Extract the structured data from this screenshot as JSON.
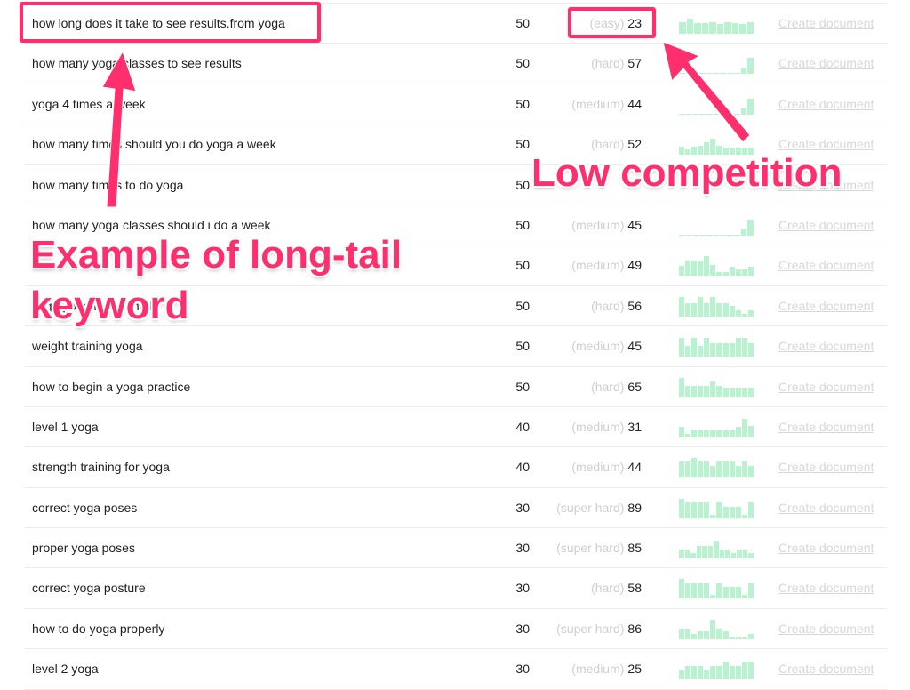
{
  "rows": [
    {
      "keyword": "how long does it take to see results.from yoga",
      "volume": "50",
      "difficulty_label": "(easy)",
      "difficulty": "23",
      "trend": [
        0.6,
        0.75,
        0.55,
        0.55,
        0.6,
        0.5,
        0.6,
        0.55,
        0.5,
        0.6
      ],
      "action": "Create document"
    },
    {
      "keyword": "how many yoga classes to see results",
      "volume": "50",
      "difficulty_label": "(hard)",
      "difficulty": "57",
      "trend": [
        0.02,
        0.02,
        0.02,
        0.02,
        0.02,
        0.02,
        0.02,
        0.02,
        0.02,
        0.3,
        0.8
      ],
      "action": "Create document"
    },
    {
      "keyword": "yoga 4 times a week",
      "volume": "50",
      "difficulty_label": "(medium)",
      "difficulty": "44",
      "trend": [
        0.02,
        0.02,
        0.02,
        0.02,
        0.02,
        0.02,
        0.02,
        0.02,
        0.02,
        0.3,
        0.8
      ],
      "action": "Create document"
    },
    {
      "keyword": "how many times should you do yoga a week",
      "volume": "50",
      "difficulty_label": "(hard)",
      "difficulty": "52",
      "trend": [
        0.4,
        0.25,
        0.4,
        0.45,
        0.65,
        0.8,
        0.45,
        0.35,
        0.3,
        0.35,
        0.35,
        0.35
      ],
      "action": "Create document"
    },
    {
      "keyword": "how many times to do yoga",
      "volume": "50",
      "difficulty_label": "",
      "difficulty": "",
      "trend": [],
      "action": "Create document"
    },
    {
      "keyword": "how many yoga classes should i do a week",
      "volume": "50",
      "difficulty_label": "(medium)",
      "difficulty": "45",
      "trend": [
        0.02,
        0.02,
        0.02,
        0.02,
        0.02,
        0.02,
        0.02,
        0.02,
        0.02,
        0.3,
        0.8
      ],
      "action": "Create document"
    },
    {
      "keyword": "",
      "volume": "50",
      "difficulty_label": "(medium)",
      "difficulty": "49",
      "trend": [
        0.5,
        0.75,
        0.75,
        0.75,
        1.0,
        0.55,
        0.2,
        0.2,
        0.45,
        0.3,
        0.3,
        0.45
      ],
      "action": "Create document"
    },
    {
      "keyword": "yoga good for strength",
      "volume": "50",
      "difficulty_label": "(hard)",
      "difficulty": "56",
      "trend": [
        1.0,
        0.7,
        0.7,
        1.0,
        0.7,
        1.0,
        0.7,
        0.7,
        0.55,
        0.3,
        0.15,
        0.3
      ],
      "action": "Create document"
    },
    {
      "keyword": "weight training yoga",
      "volume": "50",
      "difficulty_label": "(medium)",
      "difficulty": "45",
      "trend": [
        0.95,
        0.55,
        0.95,
        0.55,
        0.95,
        0.7,
        0.7,
        0.7,
        0.7,
        0.95,
        0.95,
        0.7
      ],
      "action": "Create document"
    },
    {
      "keyword": "how to begin a yoga practice",
      "volume": "50",
      "difficulty_label": "(hard)",
      "difficulty": "65",
      "trend": [
        1.0,
        0.6,
        0.6,
        0.6,
        0.6,
        0.8,
        0.6,
        0.5,
        0.5,
        0.5,
        0.5,
        0.5
      ],
      "action": "Create document"
    },
    {
      "keyword": "level 1 yoga",
      "volume": "40",
      "difficulty_label": "(medium)",
      "difficulty": "31",
      "trend": [
        0.55,
        0.2,
        0.35,
        0.35,
        0.35,
        0.35,
        0.35,
        0.35,
        0.35,
        0.55,
        0.95,
        0.6
      ],
      "action": "Create document"
    },
    {
      "keyword": "strength training for yoga",
      "volume": "40",
      "difficulty_label": "(medium)",
      "difficulty": "44",
      "trend": [
        0.8,
        0.8,
        1.0,
        0.8,
        0.8,
        0.6,
        0.8,
        0.8,
        0.8,
        0.6,
        0.8,
        0.6
      ],
      "action": "Create document"
    },
    {
      "keyword": "correct yoga poses",
      "volume": "30",
      "difficulty_label": "(super hard)",
      "difficulty": "89",
      "trend": [
        1.0,
        0.8,
        0.8,
        0.8,
        0.8,
        0.2,
        0.8,
        0.6,
        0.6,
        0.6,
        0.2,
        0.8
      ],
      "action": "Create document"
    },
    {
      "keyword": "proper yoga poses",
      "volume": "30",
      "difficulty_label": "(super hard)",
      "difficulty": "85",
      "trend": [
        0.45,
        0.45,
        0.25,
        0.65,
        0.65,
        0.65,
        0.9,
        0.45,
        0.45,
        0.25,
        0.45,
        0.45,
        0.25
      ],
      "action": "Create document"
    },
    {
      "keyword": "correct yoga posture",
      "volume": "30",
      "difficulty_label": "(hard)",
      "difficulty": "58",
      "trend": [
        1.0,
        0.75,
        0.75,
        0.75,
        0.75,
        0.2,
        0.75,
        0.6,
        0.6,
        0.6,
        0.2,
        0.75
      ],
      "action": "Create document"
    },
    {
      "keyword": "how to do yoga properly",
      "volume": "30",
      "difficulty_label": "(super hard)",
      "difficulty": "86",
      "trend": [
        0.55,
        0.55,
        0.25,
        0.4,
        0.4,
        1.0,
        0.55,
        0.4,
        0.15,
        0.15,
        0.15,
        0.25
      ],
      "action": "Create document"
    },
    {
      "keyword": "level 2 yoga",
      "volume": "30",
      "difficulty_label": "(medium)",
      "difficulty": "25",
      "trend": [
        0.45,
        0.7,
        0.7,
        0.7,
        0.45,
        0.7,
        0.7,
        0.9,
        0.7,
        0.7,
        0.9,
        0.9
      ],
      "action": "Create document"
    }
  ],
  "annotations": {
    "long_tail_line1": "Example of long-tail",
    "long_tail_line2": "keyword",
    "low_competition": "Low competition",
    "color": "#ff2e6c"
  },
  "colors": {
    "sparkline": "#b8f2cf",
    "muted_text": "#cfcfcf",
    "link": "#d8d8d8"
  }
}
